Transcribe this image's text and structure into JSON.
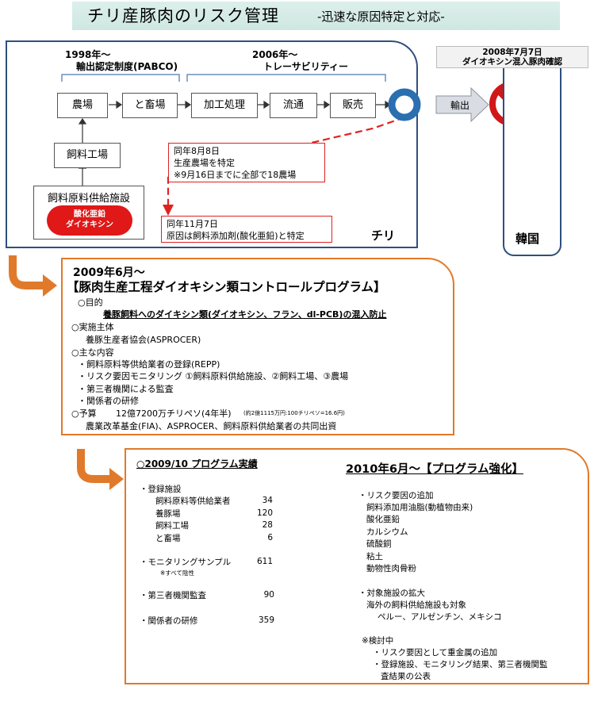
{
  "title": {
    "main": "チリ産豚肉のリスク管理",
    "sub": "-迅速な原因特定と対応-"
  },
  "chile": {
    "pabco_year": "1998年～",
    "pabco_label": "輸出認定制度(PABCO)",
    "trace_year": "2006年～",
    "trace_label": "トレーサビリティー",
    "nodes": [
      "農場",
      "と畜場",
      "加工処理",
      "流通",
      "販売"
    ],
    "feed_factory": "飼料工場",
    "feed_supplier": "飼料原料供給施設",
    "blob_text": "酸化亜鉛\nダイオキシン",
    "aug_box": [
      "同年8月8日",
      "生産農場を特定",
      "※9月16日までに全部で18農場"
    ],
    "nov_box": [
      "同年11月7日",
      "原因は飼料添加剤(酸化亜鉛)と特定"
    ],
    "country": "チリ"
  },
  "export_label": "輸出",
  "korea": {
    "callout": [
      "2008年7月7日",
      "ダイオキシン混入豚肉確認"
    ],
    "country": "韓国"
  },
  "program2009": {
    "date": "2009年6月～",
    "name": "【豚肉生産工程ダイオキシン類コントロールプログラム】",
    "lines": [
      "○目的",
      "養豚飼料へのダイキシン類(ダイオキシン、フラン、dl-PCB)の混入防止",
      "○実施主体",
      "養豚生産者協会(ASPROCER)",
      "○主な内容",
      "・飼料原料等供給業者の登録(REPP)",
      "・リスク要因モニタリング ①飼料原料供給施設、②飼料工場、③農場",
      "・第三者機関による監査",
      "・関係者の研修",
      "○予算",
      "12億7200万チリペソ(4年半)",
      "(約2億1115万円:100チリペソ=16.6円)",
      "農業改革基金(FIA)、ASPROCER、飼料原料供給業者の共同出資"
    ]
  },
  "results2009": {
    "header": "○2009/10 プログラム実績",
    "registered": "・登録施設",
    "items": [
      {
        "label": "飼料原料等供給業者",
        "value": "34"
      },
      {
        "label": "養豚場",
        "value": "120"
      },
      {
        "label": "飼料工場",
        "value": "28"
      },
      {
        "label": "と畜場",
        "value": "6"
      }
    ],
    "monitoring": {
      "label": "・モニタリングサンプル",
      "value": "611"
    },
    "monitoring_note": "※すべて陰性",
    "audit": {
      "label": "・第三者機関監査",
      "value": "90"
    },
    "training": {
      "label": "・関係者の研修",
      "value": "359"
    }
  },
  "program2010": {
    "header": "2010年6月～【プログラム強化】",
    "lines": [
      "・リスク要因の追加",
      "飼料添加用油脂(動植物由来)",
      "酸化亜鉛",
      "カルシウム",
      "硫酸銅",
      "粘土",
      "動物性肉骨粉",
      "・対象施設の拡大",
      "海外の飼料供給施設も対象",
      "ペルー、アルゼンチン、メキシコ",
      "※検討中",
      "・リスク要因として重金属の追加",
      "・登録施設、モニタリング結果、第三者機関監",
      "査結果の公表"
    ]
  },
  "colors": {
    "navy": "#2f4f7f",
    "orange": "#e07a2a",
    "red": "#d22222",
    "ring": "#2a6fb0"
  }
}
